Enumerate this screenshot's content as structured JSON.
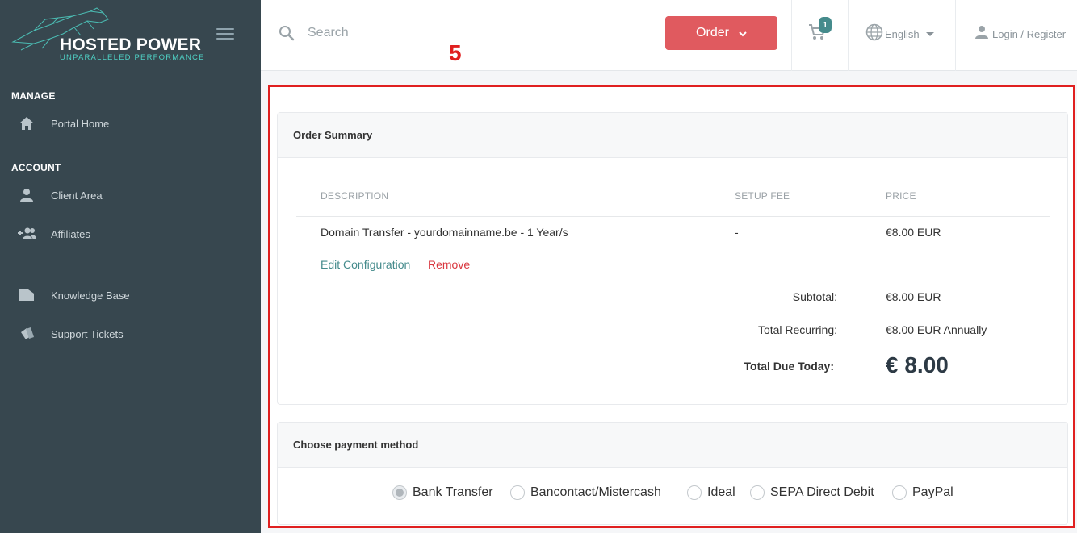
{
  "brand": {
    "title": "HOSTED POWER",
    "subtitle": "UNPARALLELED PERFORMANCE"
  },
  "sidebar": {
    "sections": [
      {
        "title": "MANAGE",
        "items": [
          {
            "label": "Portal Home",
            "icon": "home-icon"
          }
        ]
      },
      {
        "title": "ACCOUNT",
        "items": [
          {
            "label": "Client Area",
            "icon": "user-icon"
          },
          {
            "label": "Affiliates",
            "icon": "add-users-icon"
          }
        ]
      },
      {
        "title": "",
        "items": [
          {
            "label": "Knowledge Base",
            "icon": "folder-icon"
          },
          {
            "label": "Support Tickets",
            "icon": "tickets-icon"
          }
        ]
      }
    ]
  },
  "header": {
    "search_placeholder": "Search",
    "order_label": "Order",
    "cart_count": "1",
    "language": "English",
    "login_label": "Login / Register"
  },
  "annotation": "5",
  "order_summary": {
    "title": "Order Summary",
    "columns": [
      "DESCRIPTION",
      "SETUP FEE",
      "PRICE"
    ],
    "item": {
      "description": "Domain Transfer - yourdomainname.be - 1 Year/s",
      "setup_fee": "-",
      "price": "€8.00 EUR"
    },
    "edit_label": "Edit Configuration",
    "remove_label": "Remove",
    "subtotal_label": "Subtotal:",
    "subtotal_value": "€8.00 EUR",
    "recurring_label": "Total Recurring:",
    "recurring_value": "€8.00 EUR Annually",
    "due_label": "Total Due Today:",
    "due_value": "€ 8.00"
  },
  "payment": {
    "title": "Choose payment method",
    "selected": "Bank Transfer",
    "options": [
      "Bank Transfer",
      "Bancontact/Mistercash",
      "Ideal",
      "SEPA Direct Debit",
      "PayPal"
    ]
  },
  "colors": {
    "sidebar_bg": "#37474f",
    "order_button": "#e05a5f",
    "link_teal": "#458b8c",
    "remove_red": "#d9363e",
    "annotation_red": "#e02020"
  }
}
